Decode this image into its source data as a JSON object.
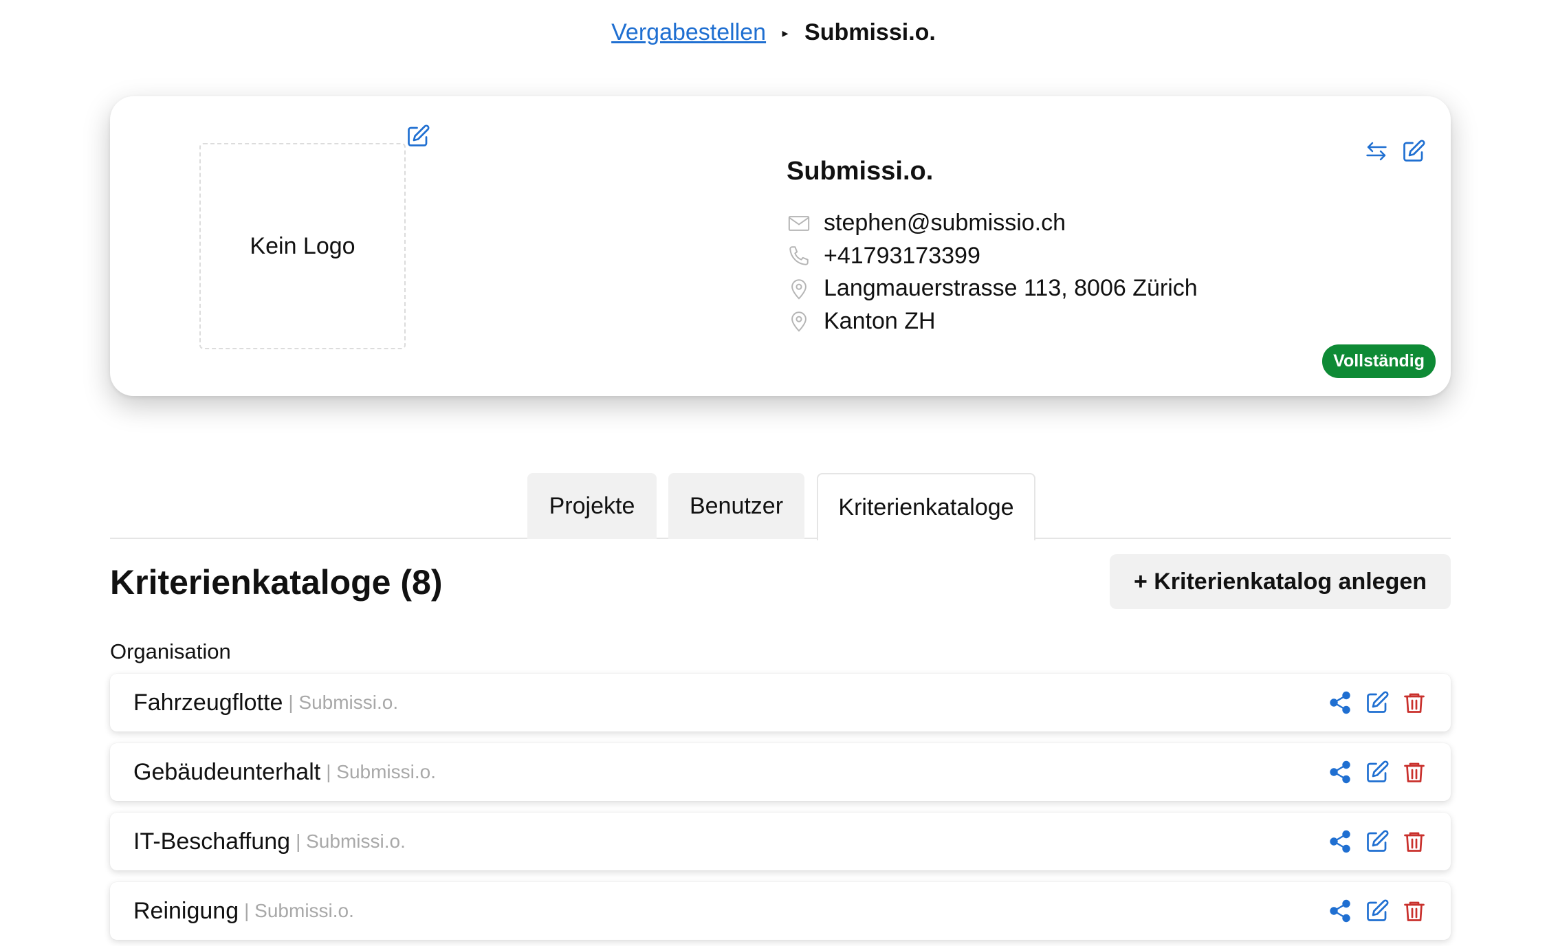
{
  "breadcrumb": {
    "parent": "Vergabestellen",
    "separator": "▸",
    "current": "Submissi.o."
  },
  "org": {
    "logo_placeholder": "Kein Logo",
    "name": "Submissi.o.",
    "email": "stephen@submissio.ch",
    "phone": "+41793173399",
    "address": "Langmauerstrasse 113, 8006 Zürich",
    "canton": "Kanton ZH",
    "status": "Vollständig",
    "status_color": "#0e8a35"
  },
  "tabs": [
    {
      "label": "Projekte"
    },
    {
      "label": "Benutzer"
    },
    {
      "label": "Kriterienkataloge"
    }
  ],
  "section": {
    "title": "Kriterienkataloge (8)",
    "add_label": "+ Kriterienkatalog anlegen",
    "group_label": "Organisation"
  },
  "catalogs": [
    {
      "name": "Fahrzeugflotte",
      "owner": "| Submissi.o."
    },
    {
      "name": "Gebäudeunterhalt",
      "owner": "| Submissi.o."
    },
    {
      "name": "IT-Beschaffung",
      "owner": "| Submissi.o."
    },
    {
      "name": "Reinigung",
      "owner": "| Submissi.o."
    }
  ],
  "colors": {
    "accent": "#1f6fd1",
    "danger": "#c9302c",
    "muted_icon": "#b5b5b5"
  },
  "icons": [
    "edit-icon",
    "swap-icon",
    "mail-icon",
    "phone-icon",
    "location-icon",
    "share-icon",
    "trash-icon"
  ]
}
